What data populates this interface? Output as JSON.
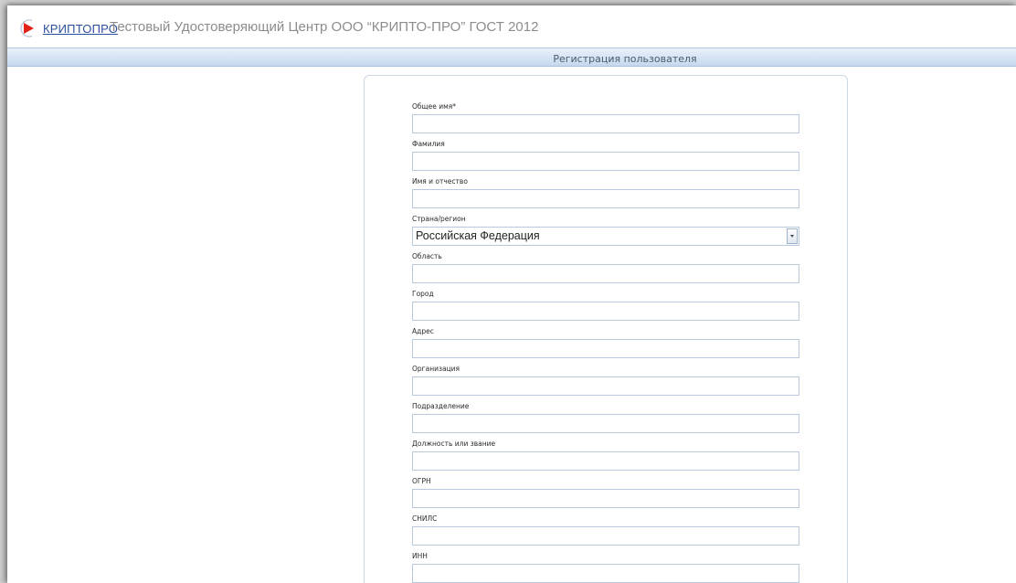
{
  "header": {
    "logo_text": "КРИПТОПРО",
    "site_title": "Тестовый Удостоверяющий Центр ООО “КРИПТО-ПРО” ГОСТ 2012"
  },
  "section": {
    "title": "Регистрация пользователя"
  },
  "form": {
    "fields": [
      {
        "label": "Общее имя*",
        "value": ""
      },
      {
        "label": "Фамилия",
        "value": ""
      },
      {
        "label": "Имя и отчество",
        "value": ""
      },
      {
        "label": "Страна/регион",
        "value": "Российская Федерация",
        "type": "select"
      },
      {
        "label": "Область",
        "value": ""
      },
      {
        "label": "Город",
        "value": ""
      },
      {
        "label": "Адрес",
        "value": ""
      },
      {
        "label": "Организация",
        "value": ""
      },
      {
        "label": "Подразделение",
        "value": ""
      },
      {
        "label": "Должность или звание",
        "value": ""
      },
      {
        "label": "ОГРН",
        "value": ""
      },
      {
        "label": "СНИЛС",
        "value": ""
      },
      {
        "label": "ИНН",
        "value": ""
      }
    ]
  },
  "colors": {
    "brand_red": "#e2231a",
    "brand_blue": "#2c4f9e",
    "input_border": "#b8c9de"
  }
}
